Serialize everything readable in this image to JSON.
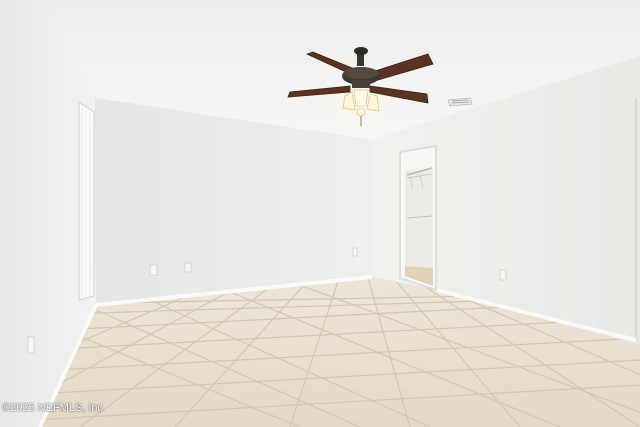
{
  "photo": {
    "subject": "empty-room-with-ceiling-fan",
    "watermark": "©2025 NEFMLS, Inc",
    "colors": {
      "ceiling": "#f4f5f3",
      "wall_back": "#e9eae8",
      "wall_left": "#eeeeec",
      "wall_right": "#ecedea",
      "floor_tile": "#e6dccb",
      "grout": "#cfc4b2",
      "baseboard": "#f7f7f5",
      "fan_blade": "#5a3322",
      "fan_metal": "#3b3530",
      "light_glow": "#fff7d8"
    }
  }
}
